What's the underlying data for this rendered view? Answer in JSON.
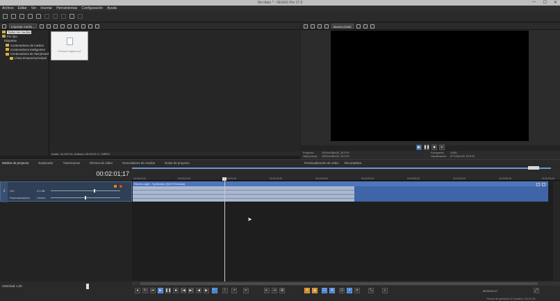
{
  "window": {
    "title": "Sin título * - VEGAS Pro 17.0",
    "controls": [
      "—",
      "☐",
      "✕"
    ]
  },
  "menu": [
    "Archivo",
    "Editar",
    "Ver",
    "Insertar",
    "Herramientas",
    "Configuración",
    "Ayuda"
  ],
  "explorer": {
    "dropdown": "Importar medio...",
    "tree": [
      {
        "label": "Todos los medios",
        "selected": true
      },
      {
        "label": "Por tipo",
        "selected": false
      },
      {
        "label": "Etiquetas",
        "selected": false
      },
      {
        "label": "Contenedores de medios",
        "selected": false
      },
      {
        "label": "Contenedores inteligentes",
        "selected": false
      },
      {
        "label": "Contenedores de Storyboard",
        "selected": false
      },
      {
        "label": "Línea temporal principal",
        "selected": false
      }
    ],
    "thumbnail_caption": "Evolución bajada.mp4",
    "status": "Audio: 44,100 Hz, Estéreo, 00:00:02,17, MPEG"
  },
  "tabs_left": [
    "Medios de proyecto",
    "Explorador",
    "Transiciones",
    "Efectos de vídeo",
    "Generadores de medios",
    "Notas de proyecto"
  ],
  "tabs_right": [
    "Previsualización de vídeo",
    "Recortadora"
  ],
  "preview": {
    "dropdown": "Buena (total)",
    "info": {
      "proyecto_label": "Proyecto:",
      "proyecto_value": "1920x1080x32, 29,970i",
      "vista_previa_label": "Vista previa:",
      "vista_previa_value": "1920x1080x32, 29,970i",
      "fotograma_label": "Fotograma:",
      "fotograma_value": "3.656",
      "visualizacion_label": "Visualización:",
      "visualizacion_value": "677x381x32, 29,970i"
    }
  },
  "timeline": {
    "timecode": "00:02:01;17",
    "ruler_labels": [
      "00:00:00;00",
      "00:00:29;29",
      "00:00:59;28",
      "00:01:29;29",
      "00:01:59;28",
      "00:02:29;29",
      "00:02:59;28",
      "00:03:29;29",
      "00:03:59;28",
      "00:04:29;29"
    ],
    "track": {
      "number": "1",
      "volume_label": "Vol.:",
      "volume_value": "0,0 dB",
      "pan_label": "Panoramización:",
      "pan_value": "Centro"
    },
    "clip_title": "Electro-Light - Symbolism [NCS Release]",
    "velocity": "Velocidad: 1,00",
    "position": "00:02:01;17",
    "render_time": "Tiempo de grabación (2 canales): 151:51:30"
  },
  "colors": {
    "accent": "#3d7bd0",
    "clip": "#3f64a8",
    "clip_light": "#aab7d0",
    "track_header": "#2f3f55"
  }
}
